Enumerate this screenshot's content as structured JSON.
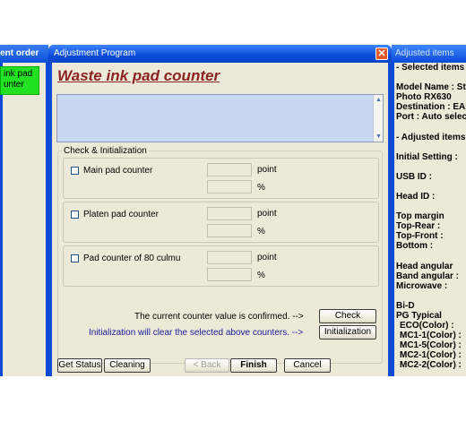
{
  "left_window": {
    "title": "nent order",
    "item_label": "ink pad\nunter"
  },
  "main_window": {
    "title": "Adjustment Program",
    "close_symbol": "✕",
    "page_title": "Waste ink pad counter",
    "group_label": "Check & Initialization",
    "pads": [
      {
        "label": "Main pad counter",
        "unit1": "point",
        "unit2": "%"
      },
      {
        "label": "Platen pad counter",
        "unit1": "point",
        "unit2": "%"
      },
      {
        "label": "Pad counter of 80 culmu",
        "unit1": "point",
        "unit2": "%"
      }
    ],
    "confirm_text": "The current counter value is confirmed. -->",
    "init_text": "Initialization will clear the selected above counters. -->",
    "check_button": "Check",
    "initialization_button": "Initialization",
    "get_status_button": "Get Status",
    "cleaning_button": "Cleaning",
    "back_button": "< Back",
    "finish_button": "Finish",
    "cancel_button": "Cancel",
    "colors": {
      "title_red": "#8b2323",
      "info_blue": "#1a1a9a",
      "titlebar_blue": "#0b4bd6"
    }
  },
  "right_window": {
    "title": "Adjusted items",
    "selected_header": "- Selected items -",
    "model_name": "Model Name : Styl",
    "model_value": "Photo RX630",
    "destination": "Destination : EAI",
    "port": "Port : Auto selecti",
    "adjusted_header": "- Adjusted items -",
    "initial_setting": "Initial Setting :",
    "usb_id": "USB ID :",
    "head_id": "Head ID :",
    "top_margin": "Top margin",
    "top_rear": "Top-Rear :",
    "top_front": "Top-Front :",
    "bottom": "Bottom :",
    "head_angular": "Head angular",
    "band_angular": "Band angular :",
    "microwave": "Microwave :",
    "bi_d": "Bi-D",
    "pg_typical": "PG Typical",
    "eco": "ECO(Color) :",
    "mc1_1": "MC1-1(Color) :",
    "mc1_5": "MC1-5(Color) :",
    "mc2_1": "MC2-1(Color) :",
    "mc2_2": "MC2-2(Color) :"
  }
}
